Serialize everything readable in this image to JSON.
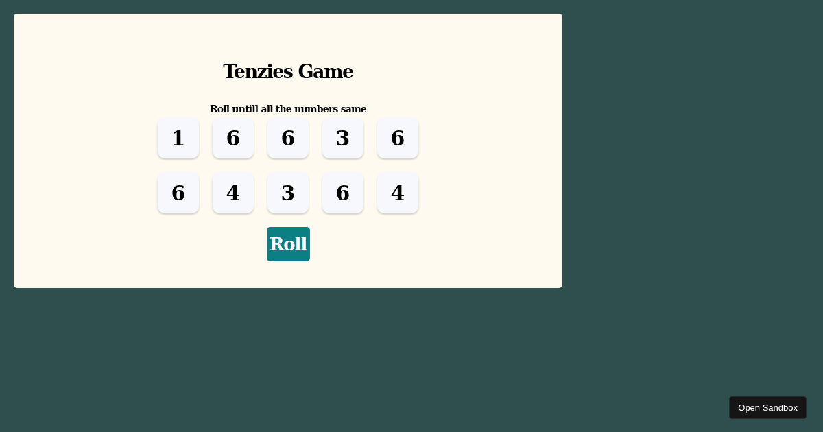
{
  "game": {
    "title": "Tenzies Game",
    "instructions": "Roll untill all the numbers same",
    "dice": [
      "1",
      "6",
      "6",
      "3",
      "6",
      "6",
      "4",
      "3",
      "6",
      "4"
    ],
    "roll_button": "Roll"
  },
  "sandbox_button": "Open Sandbox"
}
